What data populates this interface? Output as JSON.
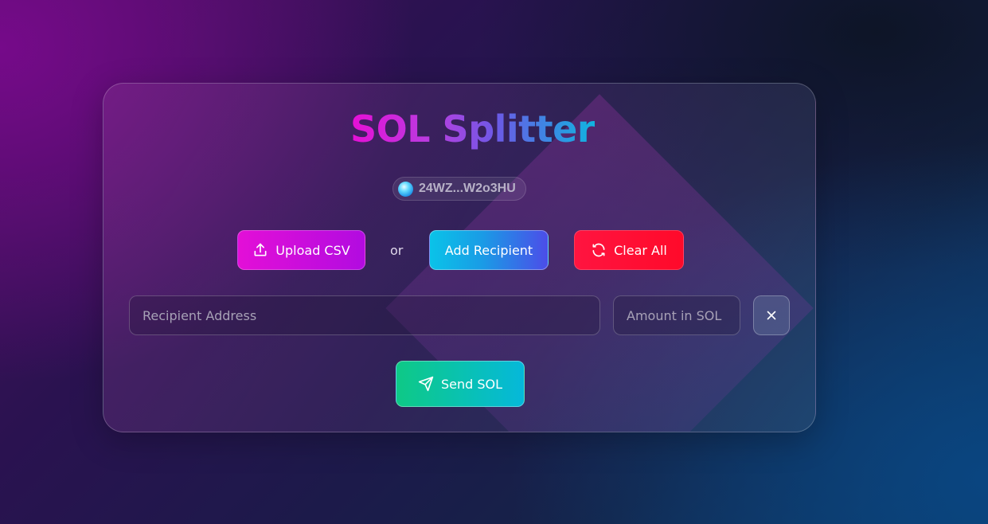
{
  "app": {
    "title": "SOL Splitter"
  },
  "wallet": {
    "address_short": "24WZ...W2o3HU"
  },
  "actions": {
    "upload_label": "Upload CSV",
    "or_label": "or",
    "add_label": "Add Recipient",
    "clear_label": "Clear All"
  },
  "recipient_row": {
    "address_placeholder": "Recipient Address",
    "address_value": "",
    "amount_placeholder": "Amount in SOL",
    "amount_value": ""
  },
  "send": {
    "label": "Send SOL"
  },
  "icons": {
    "upload": "upload-icon",
    "refresh": "refresh-icon",
    "close": "close-icon",
    "send": "send-icon"
  },
  "colors": {
    "title_gradient": [
      "#e60fd6",
      "#10b4e0"
    ],
    "upload_button": "#e30fd7",
    "add_button": "#0ac3e8",
    "clear_button": "#ff1440",
    "send_button": "#0ec986"
  }
}
